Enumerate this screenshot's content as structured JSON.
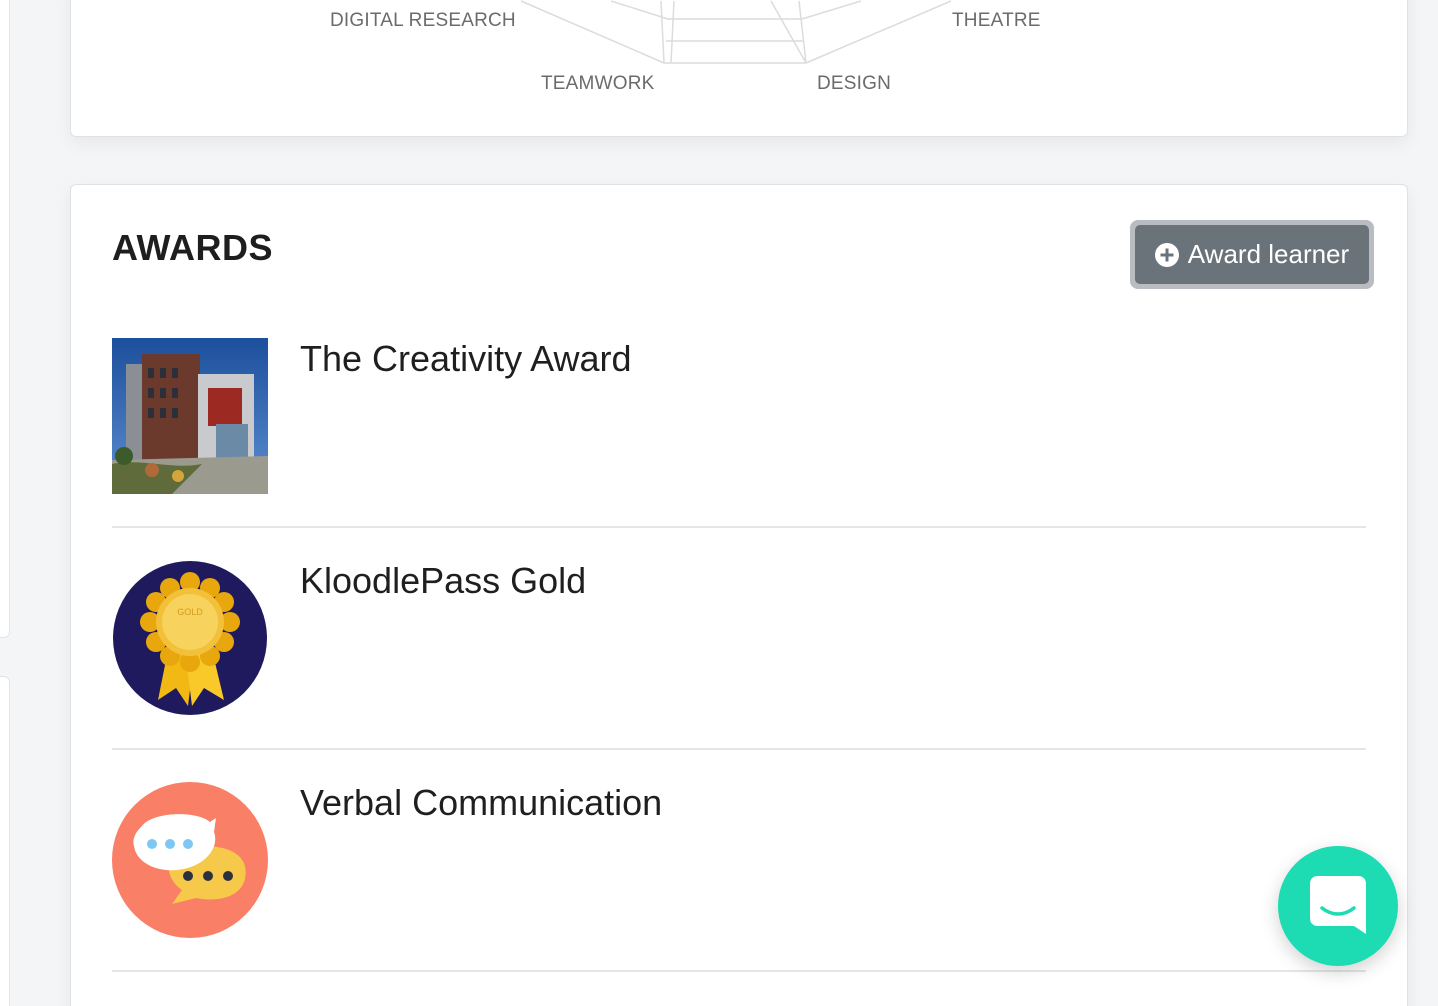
{
  "skills_chart": {
    "labels": {
      "digital_research": "DIGITAL RESEARCH",
      "theatre": "THEATRE",
      "teamwork": "TEAMWORK",
      "design": "DESIGN"
    }
  },
  "awards": {
    "title": "AWARDS",
    "award_button_label": "Award learner",
    "items": [
      {
        "name": "The Creativity Award",
        "image": "building-photo"
      },
      {
        "name": "KloodlePass Gold",
        "image": "gold-ribbon-badge",
        "badge_text": "GOLD"
      },
      {
        "name": "Verbal Communication",
        "image": "speech-bubbles-badge"
      }
    ]
  },
  "colors": {
    "button_bg": "#6b737a",
    "chat_launcher": "#1ddcb3",
    "gold_badge_bg": "#1f1a5e",
    "verbal_badge_bg": "#f97f66"
  }
}
